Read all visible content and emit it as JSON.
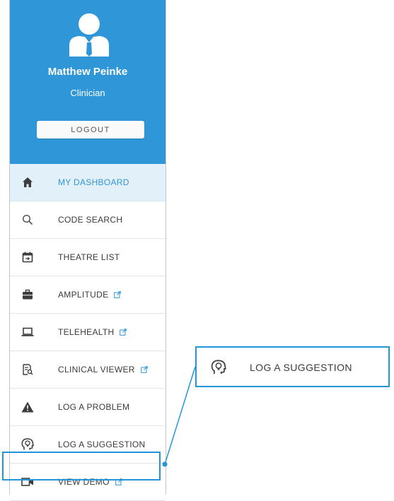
{
  "profile": {
    "name": "Matthew Peinke",
    "role": "Clinician",
    "logout_label": "LOGOUT"
  },
  "menu": {
    "items": [
      {
        "label": "MY DASHBOARD",
        "icon": "home-icon",
        "active": true
      },
      {
        "label": "CODE SEARCH",
        "icon": "search-icon"
      },
      {
        "label": "THEATRE LIST",
        "icon": "calendar-icon"
      },
      {
        "label": "AMPLITUDE",
        "icon": "briefcase-icon",
        "external": true
      },
      {
        "label": "TELEHEALTH",
        "icon": "laptop-icon",
        "external": true
      },
      {
        "label": "CLINICAL VIEWER",
        "icon": "document-search-icon",
        "external": true
      },
      {
        "label": "LOG A PROBLEM",
        "icon": "warning-icon"
      },
      {
        "label": "LOG A SUGGESTION",
        "icon": "lightbulb-head-icon"
      },
      {
        "label": "VIEW DEMO",
        "icon": "video-camera-icon",
        "external": true
      }
    ]
  },
  "callout": {
    "label": "LOG A SUGGESTION",
    "icon": "lightbulb-head-icon"
  },
  "colors": {
    "brand_blue": "#2f96d8",
    "active_bg": "#e1f0f9",
    "highlight": "#2496d8"
  }
}
